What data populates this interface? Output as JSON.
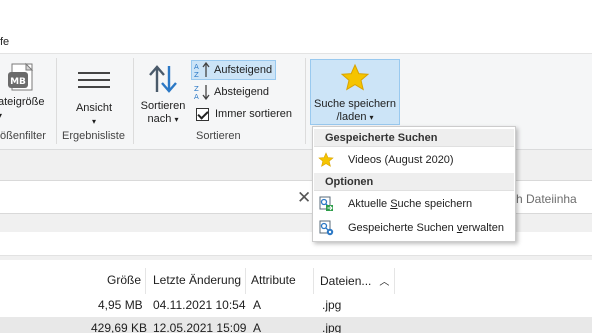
{
  "tabs": {
    "help_partial": "fe"
  },
  "ribbon": {
    "groups": [
      {
        "label": "ößenfilter",
        "button": {
          "line1": "ateigröße"
        }
      },
      {
        "label": "Ergebnisliste",
        "button": {
          "line1": "Ansicht"
        }
      },
      {
        "label": "Sortieren",
        "sort_button": {
          "line1": "Sortieren",
          "line2": "nach"
        },
        "options": {
          "ascending": "Aufsteigend",
          "descending": "Absteigend",
          "always_sort": "Immer sortieren"
        }
      }
    ],
    "save_search": {
      "line1": "Suche speichern",
      "line2": "/laden"
    },
    "size_icon_text": "MB"
  },
  "search": {
    "placeholder_partial": "ch Dateiinha"
  },
  "dropdown": {
    "section_saved": "Gespeicherte Suchen",
    "saved_items": [
      {
        "label": "Videos (August 2020)"
      }
    ],
    "section_options": "Optionen",
    "option_items": [
      {
        "label_pre": "Aktuelle ",
        "label_key": "S",
        "label_post": "uche speichern"
      },
      {
        "label_pre": "Gespeicherte Suchen ",
        "label_key": "v",
        "label_post": "erwalten"
      }
    ]
  },
  "file_list": {
    "columns": [
      "Größe",
      "Letzte Änderung",
      "Attribute",
      "Dateien..."
    ],
    "rows": [
      {
        "size": "4,95 MB",
        "modified": "04.11.2021 10:54",
        "attr": "A",
        "ext": ".jpg"
      },
      {
        "size": "429,69 KB",
        "modified": "12.05.2021 15:09",
        "attr": "A",
        "ext": ".jpg"
      }
    ]
  },
  "colors": {
    "accent": "#cce4f7",
    "accent_border": "#99c9ef",
    "star": "#f5c400"
  }
}
